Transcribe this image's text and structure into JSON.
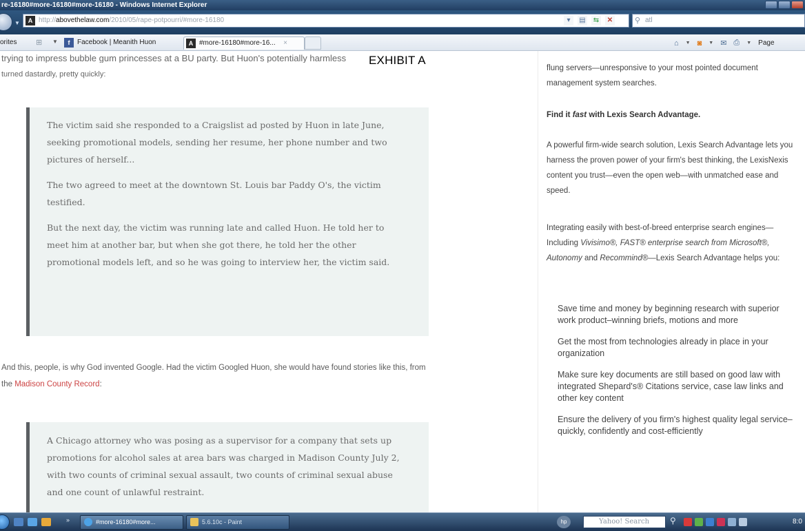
{
  "window": {
    "title": "re-16180#more-16180#more-16180 - Windows Internet Explorer"
  },
  "address_bar": {
    "url_protocol": "http://",
    "url_domain": "abovethelaw.com",
    "url_path": "/2010/05/rape-potpourri/#more-16180",
    "search_text": "atl"
  },
  "favorites_bar": {
    "label": "orites",
    "tabs": [
      {
        "label": "Facebook | Meanith Huon",
        "icon": "facebook-icon"
      },
      {
        "label": "#more-16180#more-16...",
        "icon": "site-icon",
        "close": "×"
      }
    ],
    "command_page": "Page"
  },
  "article": {
    "exhibit_label": "EXHIBIT A",
    "cut_line": "trying to impress bubble gum princesses at a BU party. But Huon's potentially harmless",
    "lead_line2": "turned dastardly, pretty quickly:",
    "quote1": [
      "The victim said she responded to a Craigslist ad posted by Huon in late June, seeking promotional models, sending her resume, her phone number and two pictures of herself...",
      "The two agreed to meet at the downtown St. Louis bar Paddy O's, the victim testified.",
      "But the next day, the victim was running late and called Huon. He told her to meet him at another bar, but when she got there, he told her the other promotional models left, and so he was going to interview her, the victim said."
    ],
    "body_text": "And this, people, is why God invented Google. Had the victim Googled Huon, she would have found stories like this, from the ",
    "body_link": "Madison County Record",
    "body_tail": ":",
    "quote2": [
      "A Chicago attorney who was posing as a supervisor for a company that sets up promotions for alcohol sales at area bars was charged in Madison County July 2, with two counts of criminal sexual assault, two counts of criminal sexual abuse and one count of unlawful restraint."
    ]
  },
  "sidebar": {
    "top_text": "flung servers—unresponsive to your most pointed document management system searches.",
    "find_prefix": "Find it ",
    "find_emph": "fast",
    "find_suffix": " with Lexis Search Advantage.",
    "p1": "A powerful firm-wide search solution, Lexis Search Advantage lets you harness the proven power of your firm's best thinking, the LexisNexis content you trust—even the open web—with unmatched ease and speed.",
    "p2_a": "Integrating easily with best-of-breed enterprise search engines—Including ",
    "p2_b": "Vivisimo®, FAST® enterprise search from Microsoft®, Autonomy",
    "p2_c": " and ",
    "p2_d": "Recommind®",
    "p2_e": "—Lexis Search Advantage helps you:",
    "bullets": [
      "Save time and money by beginning research with superior work product–winning briefs, motions and more",
      "Get the most from technologies already in place in your organization",
      "Make sure key documents are still based on good law with integrated Shepard's® Citations service, case law links and other key content",
      "Ensure the delivery of you firm's highest quality legal service–quickly, confidently and cost-efficiently"
    ]
  },
  "taskbar": {
    "tasks": [
      {
        "label": "#more-16180#more...",
        "icon": "ie-icon"
      },
      {
        "label": "5.6.10c - Paint",
        "icon": "paint-icon"
      }
    ],
    "search_placeholder": "Yahoo! Search",
    "clock": "8:0"
  },
  "colors": {
    "link": "#cc4444",
    "quote_background": "#eef3f2",
    "quote_border": "#5b5f62"
  }
}
